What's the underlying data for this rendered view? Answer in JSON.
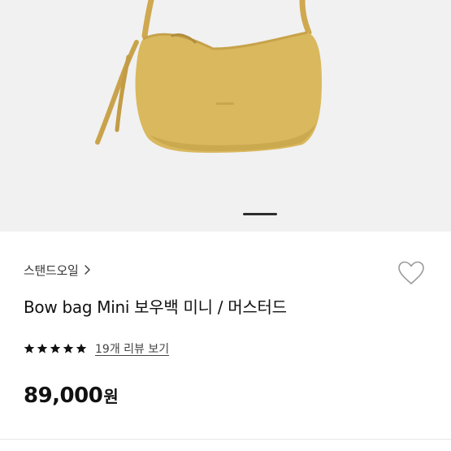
{
  "product": {
    "image_alt": "Bow bag Mini mustard",
    "gallery": {
      "current_slide": 1
    },
    "brand": {
      "name": "스탠드오일"
    },
    "title": "Bow bag Mini 보우백 미니 / 머스터드",
    "rating": {
      "stars": 5,
      "max": 5,
      "review_link": "19개 리뷰 보기"
    },
    "price": {
      "amount": "89,000",
      "currency": "원"
    }
  },
  "colors": {
    "gallery_bg": "#f1f1f1",
    "bag_body": "#d9b85e",
    "bag_shadow": "#b8963f",
    "star": "#111111",
    "heart_outline": "#9a9a9a"
  },
  "icons": {
    "brand_chevron": "chevron-right-icon",
    "wishlist": "heart-outline-icon",
    "star": "star-filled-icon"
  }
}
